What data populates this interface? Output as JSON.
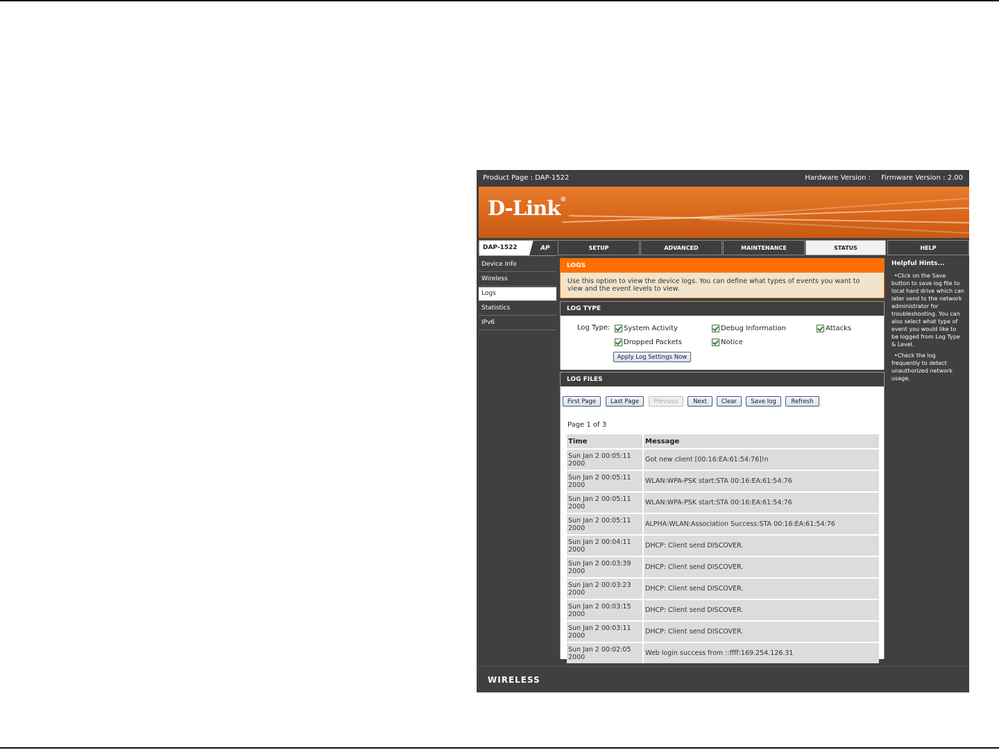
{
  "header": {
    "product_page": "Product Page : DAP-1522",
    "hardware_version": "Hardware Version :",
    "firmware_version": "Firmware Version : 2.00"
  },
  "brand": {
    "logo": "D-Link",
    "mark": "®",
    "accent": "#ff6f00"
  },
  "model": {
    "name": "DAP-1522",
    "mode": "AP"
  },
  "tabs": [
    {
      "label": "SETUP"
    },
    {
      "label": "ADVANCED"
    },
    {
      "label": "MAINTENANCE"
    },
    {
      "label": "STATUS",
      "active": true
    },
    {
      "label": "HELP"
    }
  ],
  "sidebar": {
    "items": [
      {
        "label": "Device Info"
      },
      {
        "label": "Wireless"
      },
      {
        "label": "Logs",
        "active": true
      },
      {
        "label": "Statistics"
      },
      {
        "label": "IPv6"
      }
    ]
  },
  "logs_intro": {
    "title": "LOGS",
    "text": "Use this option to view the device logs. You can define what types of events you want to view and the event levels to view."
  },
  "log_type": {
    "title": "LOG TYPE",
    "label": "Log Type:",
    "options": {
      "system_activity": "System Activity",
      "debug_information": "Debug Information",
      "attacks": "Attacks",
      "dropped_packets": "Dropped Packets",
      "notice": "Notice"
    },
    "apply_button": "Apply Log Settings Now"
  },
  "log_files": {
    "title": "LOG FILES",
    "buttons": {
      "first_page": "First Page",
      "last_page": "Last Page",
      "previous": "Previous",
      "next": "Next",
      "clear": "Clear",
      "save_log": "Save log",
      "refresh": "Refresh"
    },
    "page_info": "Page 1 of 3",
    "columns": {
      "time": "Time",
      "message": "Message"
    },
    "rows": [
      {
        "time1": "Sun Jan 2 00:05:11",
        "time2": "2000",
        "message": "Got new client [00:16:EA:61:54:76]!n"
      },
      {
        "time1": "Sun Jan 2 00:05:11",
        "time2": "2000",
        "message": "WLAN:WPA-PSK start:STA 00:16:EA:61:54:76"
      },
      {
        "time1": "Sun Jan 2 00:05:11",
        "time2": "2000",
        "message": "WLAN:WPA-PSK start:STA 00:16:EA:61:54:76"
      },
      {
        "time1": "Sun Jan 2 00:05:11",
        "time2": "2000",
        "message": "ALPHA:WLAN:Association Success:STA 00:16:EA:61:54:76"
      },
      {
        "time1": "Sun Jan 2 00:04:11",
        "time2": "2000",
        "message": "DHCP: Client send DISCOVER."
      },
      {
        "time1": "Sun Jan 2 00:03:39",
        "time2": "2000",
        "message": "DHCP: Client send DISCOVER."
      },
      {
        "time1": "Sun Jan 2 00:03:23",
        "time2": "2000",
        "message": "DHCP: Client send DISCOVER."
      },
      {
        "time1": "Sun Jan 2 00:03:15",
        "time2": "2000",
        "message": "DHCP: Client send DISCOVER."
      },
      {
        "time1": "Sun Jan 2 00:03:11",
        "time2": "2000",
        "message": "DHCP: Client send DISCOVER."
      },
      {
        "time1": "Sun Jan 2 00:02:05",
        "time2": "2000",
        "message": "Web login success from ::ffff:169.254.126.31"
      }
    ]
  },
  "hints": {
    "title": "Helpful Hints...",
    "items": [
      "Click on the Save button to save log file to local hard drive which can later send to the network administrator for troubleshooting. You can also select what type of event you would like to be logged from Log Type & Level.",
      "Check the log frequently to detect unauthorized network usage."
    ]
  },
  "footer": {
    "text": "WIRELESS"
  }
}
